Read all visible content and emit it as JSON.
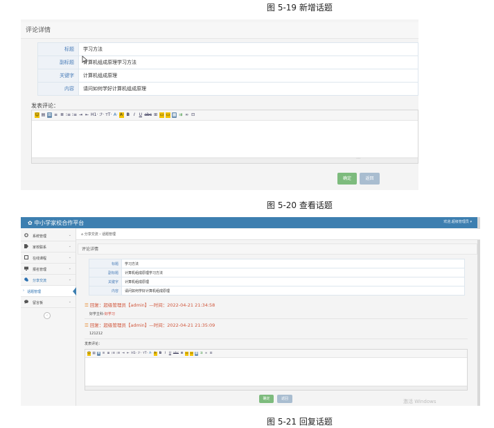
{
  "captions": {
    "fig19": "图 5-19 新增话题",
    "fig20": "图 5-20 查看话题",
    "fig21": "图 5-21 回复话题"
  },
  "shot1": {
    "card_title": "评论详情",
    "rows": [
      {
        "label": "标题",
        "value": "学习方法"
      },
      {
        "label": "副标题",
        "value": "计算机组成原理学习方法"
      },
      {
        "label": "关键字",
        "value": "计算机组成原理"
      },
      {
        "label": "内容",
        "value": "请问如何学好计算机组成原理"
      }
    ],
    "comment_label": "发表评论：",
    "ok_button": "确定",
    "back_button": "返回"
  },
  "shot2": {
    "app_title": "✿ 中小学家校合作平台",
    "user_menu": "欢迎,超级管理员 ▾",
    "nav": [
      {
        "label": "系统管理",
        "icon": "gear-icon"
      },
      {
        "label": "家校联系",
        "icon": "tag-icon"
      },
      {
        "label": "在线课程",
        "icon": "book-icon"
      },
      {
        "label": "报名管理",
        "icon": "monitor-icon"
      },
      {
        "label": "分享交流",
        "icon": "chat-icon"
      }
    ],
    "nav_sub": "话题管理",
    "nav_last": {
      "label": "留言板",
      "icon": "comment-icon"
    },
    "breadcrumb": "分享交流 › 话题管理",
    "card_title": "评论详情",
    "rows": [
      {
        "label": "标题",
        "value": "学习方法"
      },
      {
        "label": "副标题",
        "value": "计算机组成原理学习方法"
      },
      {
        "label": "关键字",
        "value": "计算机组成原理"
      },
      {
        "label": "内容",
        "value": "请问如何学好计算机组成原理"
      }
    ],
    "replies": [
      {
        "head": "回复：超级管理员【admin】—时间：2022-04-21 21:34:58",
        "body_plain": "好学主科-",
        "body_red": "好学习"
      },
      {
        "head": "回复：超级管理员【admin】—时间：2022-04-21 21:35:09",
        "body_plain": "121212",
        "body_red": ""
      }
    ],
    "comment_label": "发表评论：",
    "ok_button": "确定",
    "back_button": "返回",
    "watermark": "激活 Windows"
  },
  "toolbar_icons": [
    "☺",
    "▤",
    "⊞",
    "≡",
    "≣",
    "⁝≡",
    "⁝≡",
    "⇥",
    "⇤",
    "H1·",
    "ℱ·",
    "ᴛT·",
    "A·",
    "A·",
    "B",
    "I",
    "U",
    "abc",
    "⊞",
    "▭",
    "▭",
    "▦",
    "⇉",
    "∞",
    "⊡"
  ]
}
